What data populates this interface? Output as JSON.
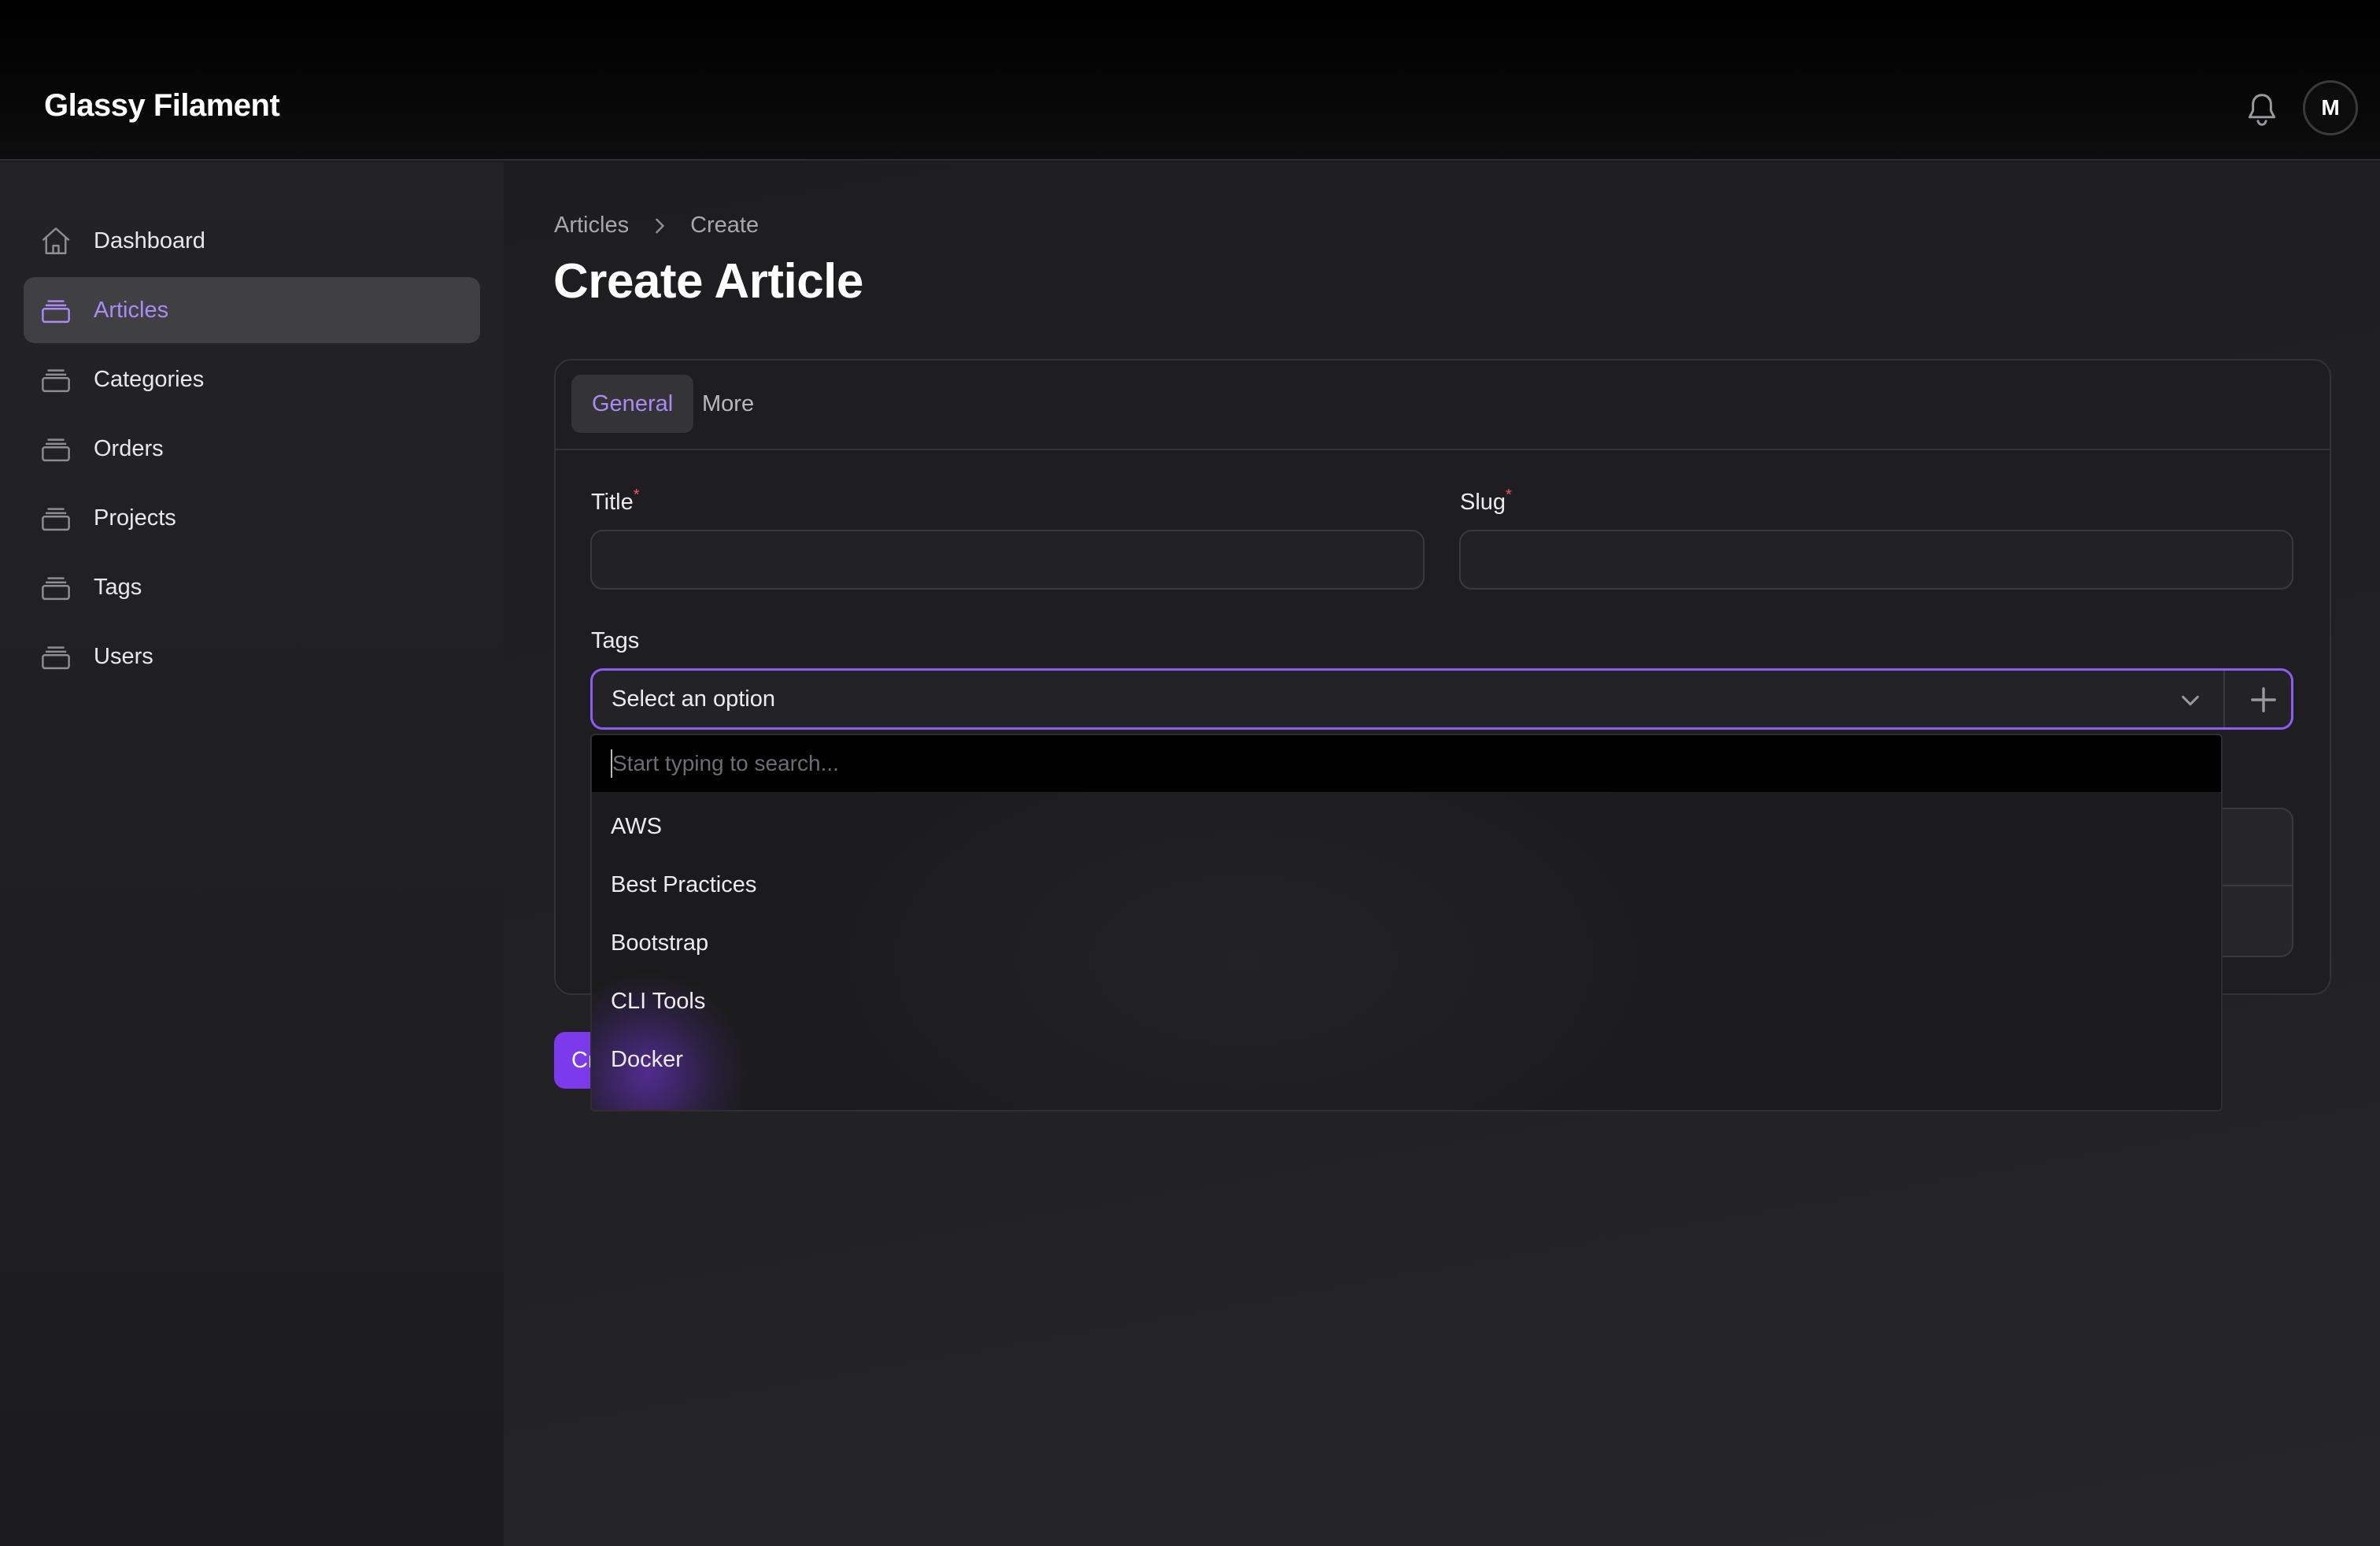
{
  "header": {
    "brand": "Glassy Filament",
    "avatar_initial": "M"
  },
  "sidebar": {
    "items": [
      {
        "label": "Dashboard",
        "icon": "home-icon"
      },
      {
        "label": "Articles",
        "icon": "stack-icon",
        "active": true
      },
      {
        "label": "Categories",
        "icon": "stack-icon"
      },
      {
        "label": "Orders",
        "icon": "stack-icon"
      },
      {
        "label": "Projects",
        "icon": "stack-icon"
      },
      {
        "label": "Tags",
        "icon": "stack-icon"
      },
      {
        "label": "Users",
        "icon": "stack-icon"
      }
    ]
  },
  "breadcrumb": [
    "Articles",
    "Create"
  ],
  "page": {
    "title": "Create Article"
  },
  "tabs": [
    {
      "label": "General",
      "active": true
    },
    {
      "label": "More",
      "active": false
    }
  ],
  "form": {
    "title_label": "Title",
    "slug_label": "Slug",
    "required_mark": "*",
    "tags_label": "Tags",
    "tags_placeholder": "Select an option",
    "create_button_partial": "Cr"
  },
  "dropdown": {
    "search_placeholder": "Start typing to search...",
    "options": [
      "AWS",
      "Best Practices",
      "Bootstrap",
      "CLI Tools",
      "Docker"
    ]
  },
  "colors": {
    "accent": "#8b5cf6",
    "accent_text": "#a98bf5",
    "button": "#7c3aed",
    "required": "#f0566b"
  }
}
